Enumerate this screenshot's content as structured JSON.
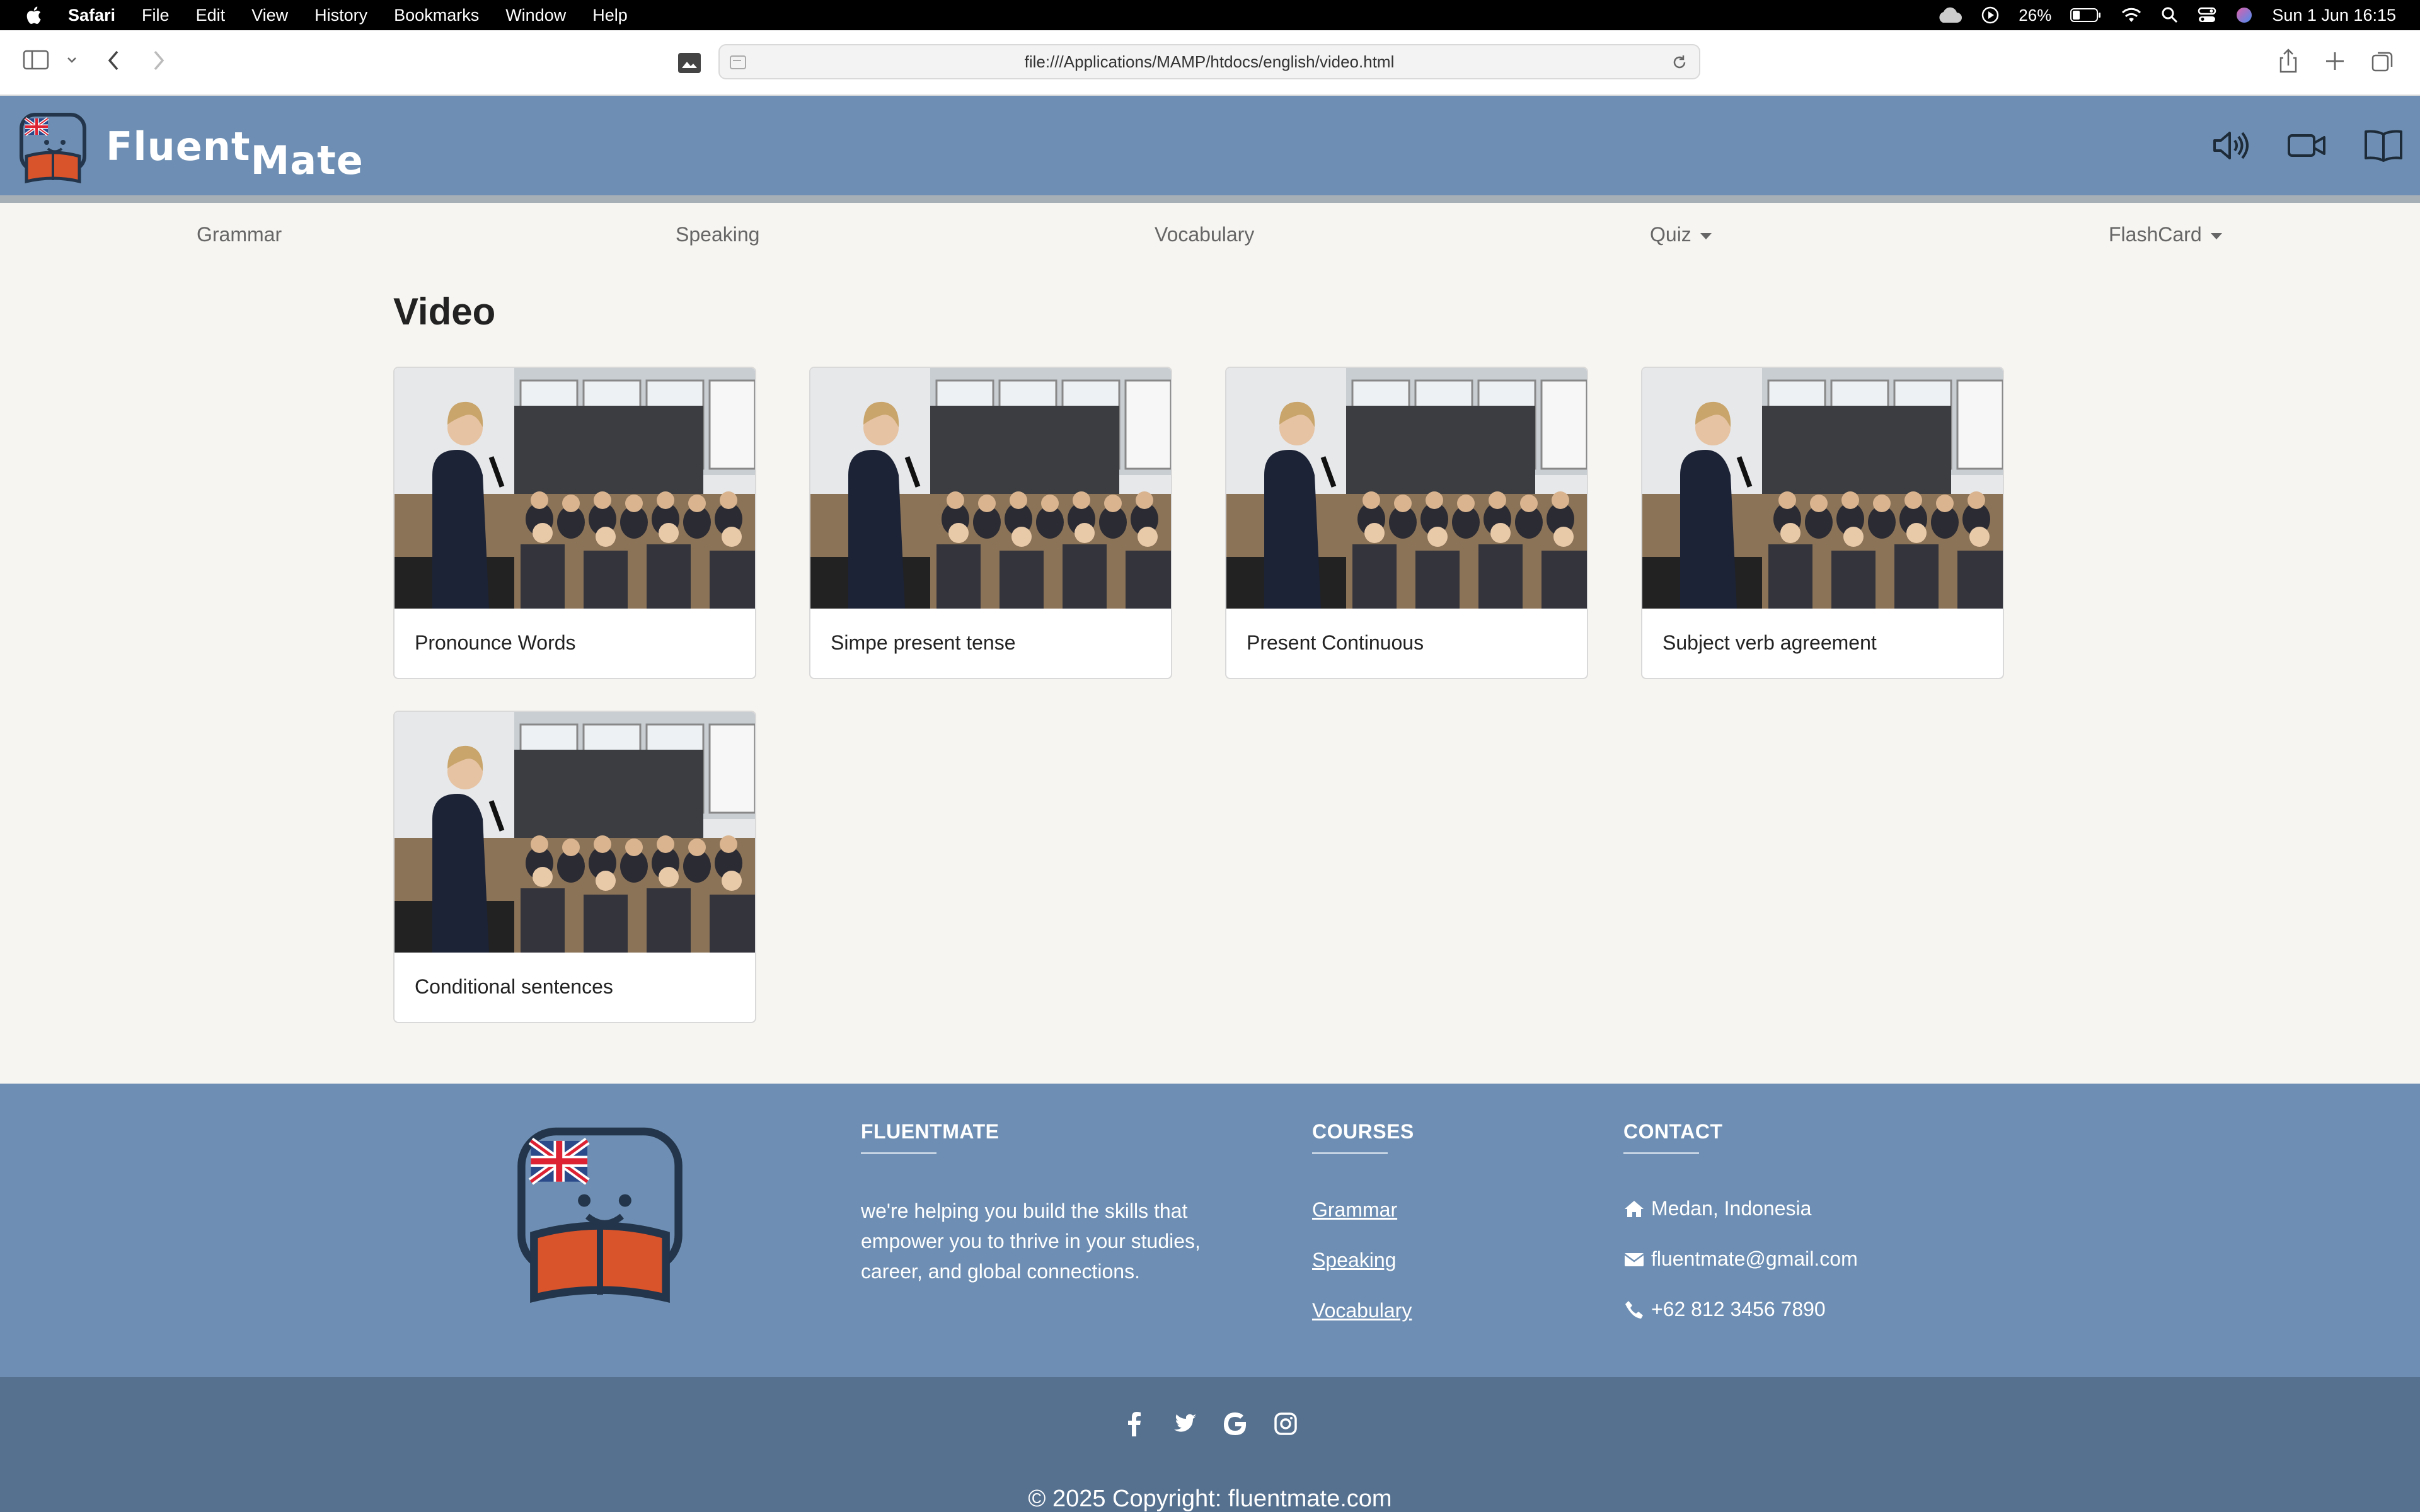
{
  "menubar": {
    "app": "Safari",
    "items": [
      "File",
      "Edit",
      "View",
      "History",
      "Bookmarks",
      "Window",
      "Help"
    ],
    "battery": "26%",
    "datetime": "Sun 1 Jun  16:15"
  },
  "browser": {
    "url": "file:///Applications/MAMP/htdocs/english/video.html"
  },
  "header": {
    "brand_part1": "Fluent",
    "brand_part2": "Mate",
    "icons": [
      "speaker-icon",
      "video-camera-icon",
      "book-icon"
    ]
  },
  "nav": {
    "items": [
      {
        "label": "Grammar",
        "dropdown": false
      },
      {
        "label": "Speaking",
        "dropdown": false
      },
      {
        "label": "Vocabulary",
        "dropdown": false
      },
      {
        "label": "Quiz",
        "dropdown": true
      },
      {
        "label": "FlashCard",
        "dropdown": true
      }
    ]
  },
  "main": {
    "title": "Video",
    "videos": [
      {
        "title": "Pronounce Words"
      },
      {
        "title": "Simpe present tense"
      },
      {
        "title": "Present Continuous"
      },
      {
        "title": "Subject verb agreement"
      },
      {
        "title": "Conditional sentences"
      }
    ]
  },
  "footer": {
    "about_heading": "FLUENTMATE",
    "about_text": "we're helping you build the skills that empower you to thrive in your studies, career, and global connections.",
    "courses_heading": "COURSES",
    "courses": [
      "Grammar",
      "Speaking",
      "Vocabulary"
    ],
    "contact_heading": "CONTACT",
    "address": "Medan, Indonesia",
    "email": "fluentmate@gmail.com",
    "phone": "+62 812 3456 7890",
    "social_icons": [
      "facebook-icon",
      "twitter-icon",
      "google-icon",
      "instagram-icon"
    ],
    "copyright": "© 2025 Copyright: fluentmate.com"
  },
  "colors": {
    "header_bg": "#6e8fb3",
    "page_bg": "#f7f5f1",
    "footer_bg": "#6e8fb3",
    "bottom_bar_bg": "#56718f"
  }
}
